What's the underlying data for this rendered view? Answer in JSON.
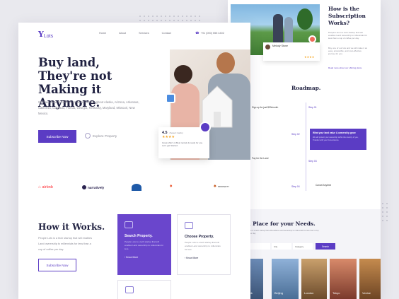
{
  "brand": {
    "logo": "Lots",
    "accent": "#5b3cc4"
  },
  "nav": {
    "items": [
      "Home",
      "About",
      "Services",
      "Contact"
    ],
    "phone": "+91 (000) 555 4402"
  },
  "hero": {
    "title": "Buy land, They're not Making it Anymore.",
    "description": "We have Land for Sale in 14 countries throughout Alaska, Arizona, Arkansas, California, Colorado, Florida, Georgia, Kentucky, Maryland, Missouri, New Mexico.",
    "cta_primary": "Subscribe Now",
    "cta_secondary": "Explore Property"
  },
  "review_card": {
    "rating": "4.5",
    "rating_note": "(Select Cards)",
    "stars": 4,
    "text": "Great offer's & Best rentals & ready for you. Let's get Started."
  },
  "partners": [
    "airbnb",
    "narratively",
    "",
    "",
    "PROPERTY"
  ],
  "how_it_works": {
    "title": "How it Works.",
    "description": "People Lots is a tech startup that will enables Land ownership to millennials for less than a cup of coffee per day.",
    "cta": "Subscribe Now",
    "cards": [
      {
        "title": "Search Property.",
        "text": "People Lots is a tech startup that will enables Land ownership to millennials for less.",
        "link": "Know More"
      },
      {
        "title": "Choose Property.",
        "text": "People Lots is a tech startup that will enables Land ownership to millennials for less.",
        "link": "Know More"
      }
    ]
  },
  "subscription": {
    "title": "How is the Subscription Works?",
    "paragraphs": [
      "People Lots is a tech startup that will enables Land ownership to millennials for less than a cup of coffee per day.",
      "Buy one of our lots and we will make it an easy, accessible, and cost-effective journey for you.",
      "Read more about our offering plans."
    ],
    "reviewer": "Melody Stone"
  },
  "roadmap": {
    "title": "Roadmap.",
    "steps": [
      {
        "label": "Step 01"
      },
      {
        "label": "Step 02"
      },
      {
        "label": "Step 03"
      },
      {
        "label": "Step 04"
      }
    ],
    "side_texts": [
      "Sign up for just $30/month",
      "Pay for the Land",
      "Cancel Anytime"
    ],
    "highlight": {
      "title": "What your land value & ownership grow",
      "text": "We will protect your ownership within the country of you, Transfer with your Convenience."
    }
  },
  "find_place": {
    "title": "d a Place for your Needs.",
    "subtitle": "People Lots is a tech startup that will enables Land ownership to millennials for less than a cup of coffee per day.",
    "selects": [
      "",
      "City",
      "Category"
    ],
    "search_label": "Search",
    "cities": [
      "New York",
      "Beijing",
      "London",
      "Tokyo",
      "Venice"
    ]
  }
}
